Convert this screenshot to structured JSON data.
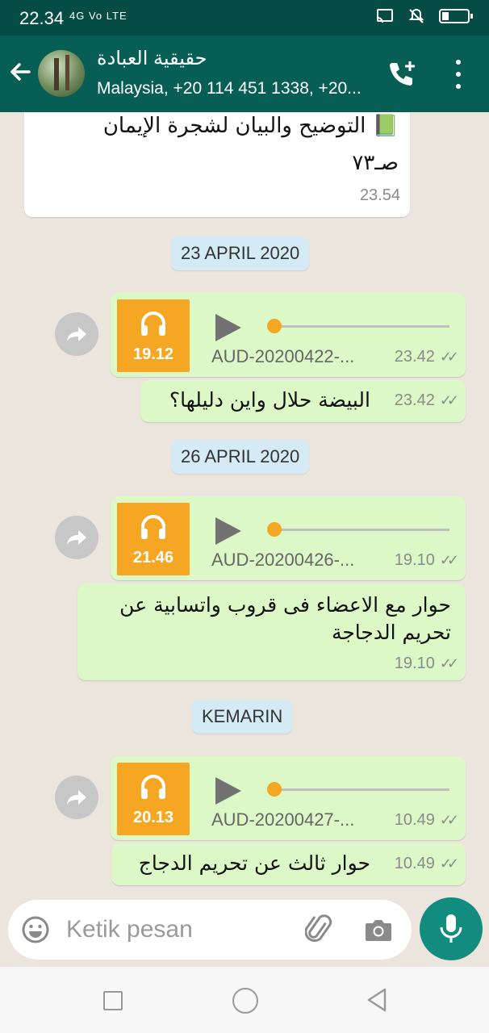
{
  "status_bar": {
    "time": "22.34",
    "signal_text": "4G Vo LTE",
    "icons": [
      "cast-icon",
      "mute-icon",
      "battery-icon"
    ]
  },
  "header": {
    "title": "حقيقية العبادة",
    "subtitle": "Malaysia, +20 114 451 1338, +20..."
  },
  "messages": [
    {
      "type": "text",
      "direction": "in",
      "line1": "📗 التوضيح والبيان لشجرة الإيمان",
      "line2": "صـ٧٣",
      "time": "23.54"
    },
    {
      "type": "date",
      "label": "23 APRIL 2020"
    },
    {
      "type": "audio",
      "direction": "out",
      "duration": "19.12",
      "filename": "AUD-20200422-...",
      "time": "23.42"
    },
    {
      "type": "text",
      "direction": "out",
      "line1": "البيضة حلال واين دليلها؟",
      "time": "23.42"
    },
    {
      "type": "date",
      "label": "26 APRIL 2020"
    },
    {
      "type": "audio",
      "direction": "out",
      "duration": "21.46",
      "filename": "AUD-20200426-...",
      "time": "19.10"
    },
    {
      "type": "text",
      "direction": "out",
      "line1": "حوار مع الاعضاء فى قروب واتسابية عن",
      "line2": "تحريم الدجاجة",
      "time": "19.10"
    },
    {
      "type": "date",
      "label": "KEMARIN"
    },
    {
      "type": "audio",
      "direction": "out",
      "duration": "20.13",
      "filename": "AUD-20200427-...",
      "time": "10.49"
    },
    {
      "type": "text",
      "direction": "out",
      "line1": "حوار ثالث عن تحريم الدجاج",
      "time": "10.49"
    }
  ],
  "input": {
    "placeholder": "Ketik pesan"
  },
  "colors": {
    "header": "#075e54",
    "statusbar": "#054d44",
    "outgoing": "#dcf8c6",
    "incoming": "#ffffff",
    "date_chip": "#d4eaf4",
    "audio_thumb": "#f5a623",
    "mic_button": "#128c7e"
  }
}
